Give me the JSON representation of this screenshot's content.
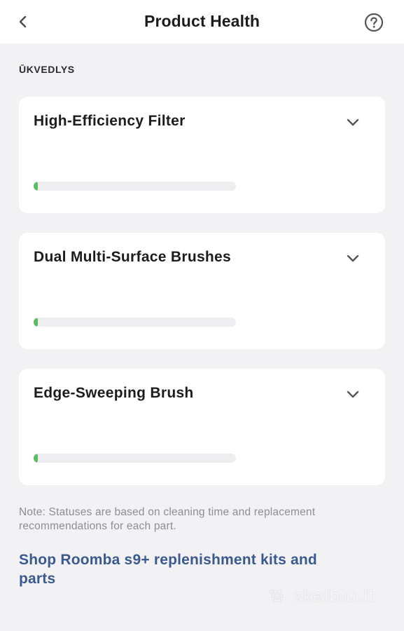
{
  "header": {
    "title": "Product Health",
    "back_icon": "chevron-left-icon",
    "help_icon": "question-circle-icon"
  },
  "section": {
    "label": "ŪKVEDLYS"
  },
  "parts": [
    {
      "name": "High-Efficiency Filter",
      "health_fraction": 0.02,
      "expand_icon": "chevron-down-icon"
    },
    {
      "name": "Dual Multi-Surface Brushes",
      "health_fraction": 0.02,
      "expand_icon": "chevron-down-icon"
    },
    {
      "name": "Edge-Sweeping Brush",
      "health_fraction": 0.02,
      "expand_icon": "chevron-down-icon"
    }
  ],
  "note": "Note: Statuses are based on cleaning time and replacement recommendations for each part.",
  "shop_link": "Shop Roomba s9+ replenishment kits and parts",
  "watermark": "skelbiu.lt",
  "colors": {
    "accent_link": "#3a5a8f",
    "progress_fill": "#5dbb63",
    "progress_track": "#eeeef0",
    "background": "#f2f2f4",
    "card": "#ffffff"
  }
}
